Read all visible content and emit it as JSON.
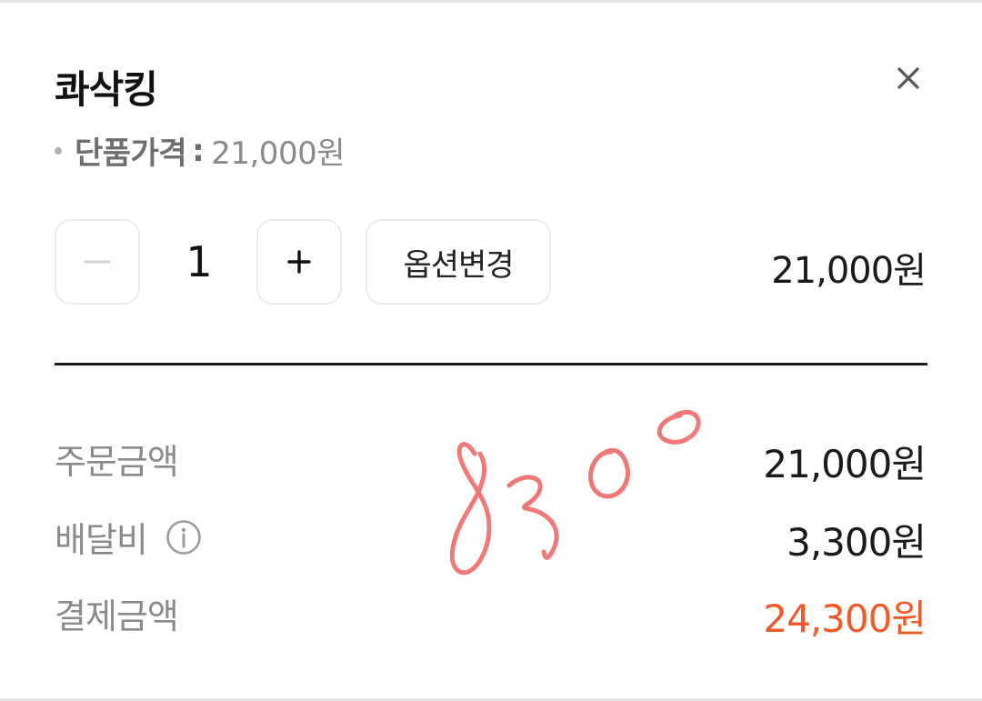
{
  "product": {
    "name": "콰삭킹",
    "unit_price_label": "단품가격",
    "unit_price_separator": ":",
    "unit_price_value": "21,000원"
  },
  "quantity": {
    "value": "1",
    "line_total": "21,000원"
  },
  "option_button_label": "옵션변경",
  "summary": {
    "order_amount_label": "주문금액",
    "order_amount_value": "21,000원",
    "delivery_fee_label": "배달비",
    "delivery_fee_value": "3,300원",
    "payment_amount_label": "결제금액",
    "payment_amount_value": "24,300원"
  },
  "handwritten_note": "8300",
  "colors": {
    "accent": "#f05a28",
    "handwriting": "#f07878",
    "muted_text": "#8a8a8a",
    "divider": "#1a1a1a"
  },
  "icons": {
    "close": "close-icon",
    "minus": "minus-icon",
    "plus": "plus-icon",
    "info": "info-icon"
  }
}
